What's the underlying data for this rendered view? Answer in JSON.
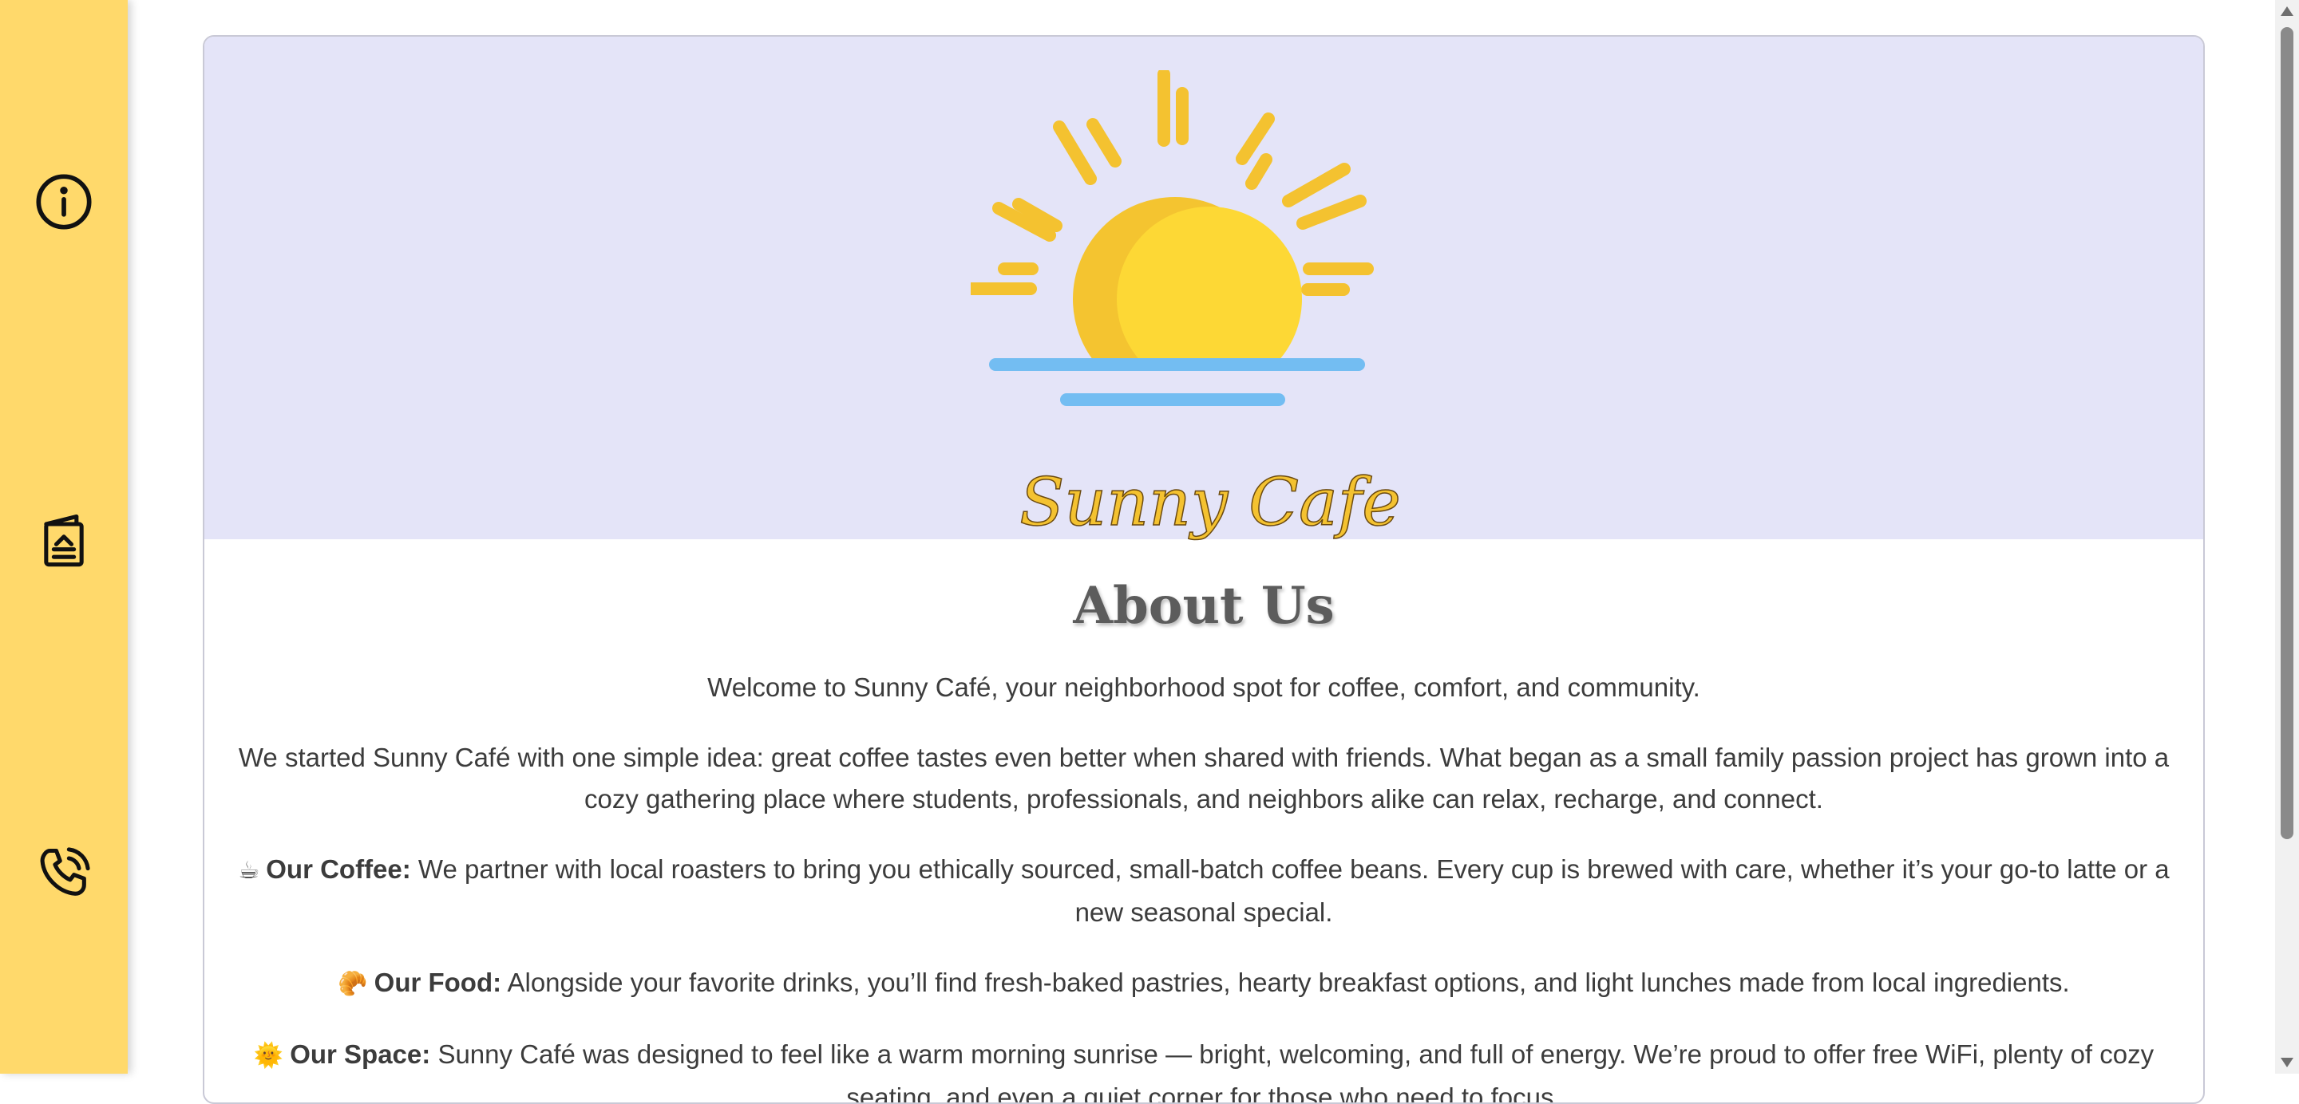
{
  "sidebar": {
    "items": [
      {
        "icon": "info-icon",
        "name": "about"
      },
      {
        "icon": "menu-icon",
        "name": "menu"
      },
      {
        "icon": "phone-icon",
        "name": "contact"
      }
    ],
    "background": "#ffd96b"
  },
  "hero": {
    "logo_text": "Sunny Cafe",
    "background": "#e4e4f8",
    "sun_color": "#fdd835",
    "water_color": "#73bdf2"
  },
  "about": {
    "title": "About Us",
    "welcome": "Welcome to Sunny Café, your neighborhood spot for coffee, comfort, and community.",
    "story": "We started Sunny Café with one simple idea: great coffee tastes even better when shared with friends. What began as a small family passion project has grown into a cozy gathering place where students, professionals, and neighbors alike can relax, recharge, and connect.",
    "coffee": {
      "emoji": "☕",
      "label": "Our Coffee:",
      "text": "We partner with local roasters to bring you ethically sourced, small-batch coffee beans. Every cup is brewed with care, whether it’s your go-to latte or a new seasonal special."
    },
    "food": {
      "emoji": "🥐",
      "label": "Our Food:",
      "text": "Alongside your favorite drinks, you’ll find fresh-baked pastries, hearty breakfast options, and light lunches made from local ingredients."
    },
    "space": {
      "emoji": "🌞",
      "label": "Our Space:",
      "text": "Sunny Café was designed to feel like a warm morning sunrise — bright, welcoming, and full of energy. We’re proud to offer free WiFi, plenty of cozy seating, and even a quiet corner for those who need to focus."
    }
  }
}
